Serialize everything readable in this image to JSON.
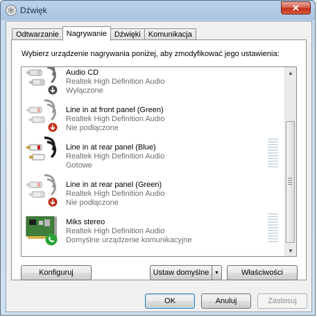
{
  "window": {
    "title": "Dźwięk",
    "close_label": "✕"
  },
  "tabs": [
    {
      "label": "Odtwarzanie",
      "active": false
    },
    {
      "label": "Nagrywanie",
      "active": true
    },
    {
      "label": "Dźwięki",
      "active": false
    },
    {
      "label": "Komunikacja",
      "active": false
    }
  ],
  "instruction": "Wybierz urządzenie nagrywania poniżej, aby zmodyfikować jego ustawienia:",
  "devices": [
    {
      "name": "Audio CD",
      "driver": "Realtek High Definition Audio",
      "status": "Wyłączone",
      "icon": "rca-cable-icon",
      "badge": "disabled-arrow-badge",
      "meter": false
    },
    {
      "name": "Line in at front panel (Green)",
      "driver": "Realtek High Definition Audio",
      "status": "Nie podłączone",
      "icon": "rca-cable-icon",
      "badge": "unplugged-red-badge",
      "meter": false
    },
    {
      "name": "Line in at rear panel (Blue)",
      "driver": "Realtek High Definition Audio",
      "status": "Gotowe",
      "icon": "rca-cable-icon",
      "badge": "none",
      "meter": true
    },
    {
      "name": "Line in at rear panel (Green)",
      "driver": "Realtek High Definition Audio",
      "status": "Nie podłączone",
      "icon": "rca-cable-icon",
      "badge": "unplugged-red-badge",
      "meter": false
    },
    {
      "name": "Miks stereo",
      "driver": "Realtek High Definition Audio",
      "status": "Domyślne urządzenie komunikacyjne",
      "icon": "sound-card-icon",
      "badge": "phone-green-badge",
      "meter": true
    }
  ],
  "buttons": {
    "configure": "Konfiguruj",
    "set_default": "Ustaw domyślne",
    "properties": "Właściwości",
    "ok": "OK",
    "cancel": "Anuluj",
    "apply": "Zastosuj"
  },
  "colors": {
    "accent_red": "#c0301a",
    "phone_green": "#2aa33a",
    "default_button_border": "#3c7fb1"
  }
}
